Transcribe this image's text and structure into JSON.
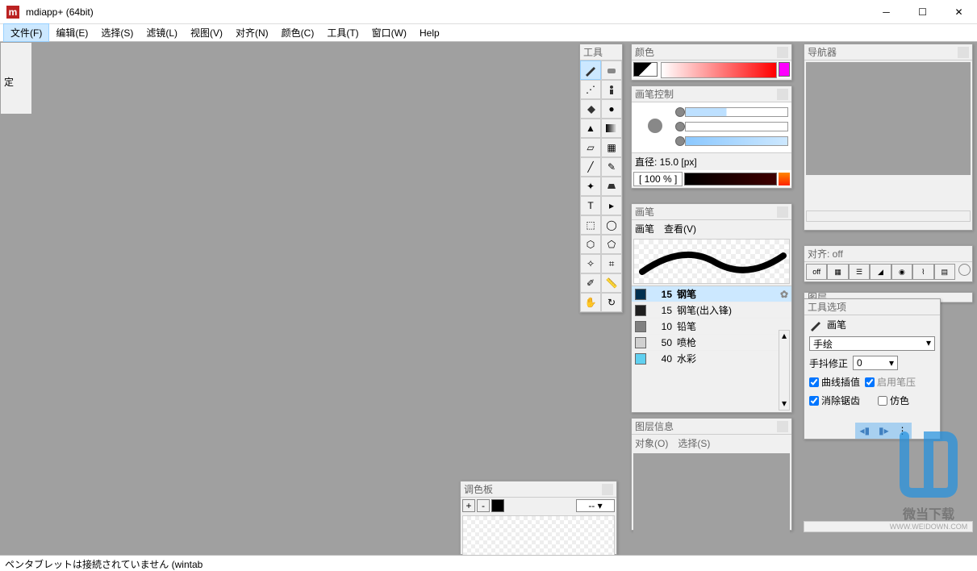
{
  "title": "mdiapp+ (64bit)",
  "menu": [
    "文件(F)",
    "编辑(E)",
    "选择(S)",
    "滤镜(L)",
    "视图(V)",
    "对齐(N)",
    "颜色(C)",
    "工具(T)",
    "窗口(W)",
    "Help"
  ],
  "panels": {
    "tools": "工具",
    "color": "颜色",
    "brushctrl": "画笔控制",
    "brush": "画笔",
    "layerinfo": "图层信息",
    "palette": "调色板",
    "nav": "导航器",
    "align": "对齐: off",
    "layer": "图层",
    "toolopt": "工具选项"
  },
  "brushctrl": {
    "size": "直径: 15.0 [px]",
    "pct": "[ 100 % ]"
  },
  "brush": {
    "menus": [
      "画笔",
      "查看(V)"
    ],
    "items": [
      {
        "size": "15",
        "name": "钢笔",
        "color": "#003050",
        "sel": true
      },
      {
        "size": "15",
        "name": "钢笔(出入锋)",
        "color": "#202020"
      },
      {
        "size": "10",
        "name": "铅笔",
        "color": "#808080"
      },
      {
        "size": "50",
        "name": "喷枪",
        "color": "#d0d0d0"
      },
      {
        "size": "40",
        "name": "水彩",
        "color": "#60d0f0"
      }
    ]
  },
  "layerinfo": {
    "menus": [
      "对象(O)",
      "选择(S)"
    ]
  },
  "palette": {
    "select": "--"
  },
  "align": {
    "off": "off"
  },
  "toolopt": {
    "tool": "画笔",
    "mode": "手绘",
    "jitter_label": "手抖修正",
    "jitter": "0",
    "curve": "曲线插值",
    "pressure": "启用笔压",
    "antialias": "消除锯齿",
    "fake": "仿色"
  },
  "lock": "定",
  "status": "ペンタブレットは接続されていません (wintab",
  "watermark": {
    "txt1": "微当下载",
    "txt2": "WWW.WEIDOWN.COM"
  }
}
